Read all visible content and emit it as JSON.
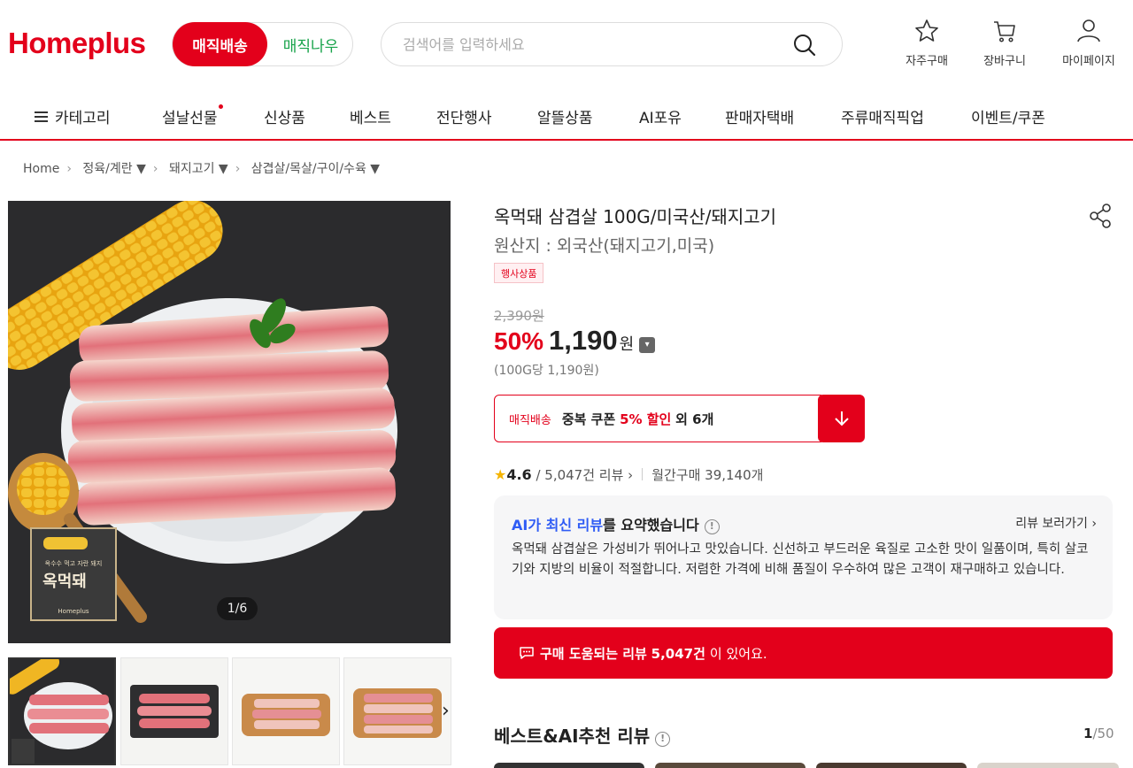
{
  "header": {
    "logo": "Homeplus",
    "toggle_on": "매직배송",
    "toggle_off": "매직나우",
    "search_placeholder": "검색어를 입력하세요",
    "icons": [
      {
        "name": "star-icon",
        "label": "자주구매"
      },
      {
        "name": "cart-icon",
        "label": "장바구니"
      },
      {
        "name": "user-icon",
        "label": "마이페이지"
      }
    ]
  },
  "nav": {
    "category": "카테고리",
    "items": [
      "설날선물",
      "신상품",
      "베스트",
      "전단행사",
      "알뜰상품",
      "AI포유",
      "판매자택배",
      "주류매직픽업",
      "이벤트/쿠폰"
    ]
  },
  "breadcrumb": [
    "Home",
    "정육/계란 ▼",
    "돼지고기 ▼",
    "삼겹살/목살/구이/수육 ▼"
  ],
  "product": {
    "title": "옥먹돼 삼겹살 100G/미국산/돼지고기",
    "origin": "원산지 : 외국산(돼지고기,미국)",
    "badge": "행사상품",
    "original_price": "2,390원",
    "discount": "50%",
    "price": "1,190",
    "currency": "원",
    "unit_price": "(100G당 1,190원)",
    "image_counter": "1/6",
    "package_label": "옥먹돼",
    "package_sub": "옥수수 먹고 자란 돼지",
    "package_brand": "Homeplus"
  },
  "coupon": {
    "tag": "매직배송",
    "text_bold": "중복 쿠폰",
    "text_red": "5% 할인",
    "text_tail": "외 6개"
  },
  "rating": {
    "score": "4.6",
    "reviews": "5,047건 리뷰",
    "monthly": "월간구매 39,140개"
  },
  "ai_summary": {
    "title_blue": "AI가 최신 리뷰",
    "title_rest": "를 요약했습니다",
    "more": "리뷰 보러가기",
    "text": "옥먹돼 삼겹살은 가성비가 뛰어나고 맛있습니다. 신선하고 부드러운 육질로 고소한 맛이 일품이며, 특히 살코기와 지방의 비율이 적절합니다. 저렴한 가격에 비해 품질이 우수하여 많은 고객이 재구매하고 있습니다."
  },
  "review_bar": {
    "prefix": "구매 도움되는 리뷰",
    "count": "5,047건",
    "suffix": "이 있어요."
  },
  "best_reviews": {
    "title": "베스트&AI추천 리뷰",
    "page_current": "1",
    "page_total": "/50"
  },
  "colors": {
    "brand_red": "#e3001b",
    "green": "#17a34a",
    "ai_blue": "#2f5cf5",
    "star": "#f5b400"
  }
}
